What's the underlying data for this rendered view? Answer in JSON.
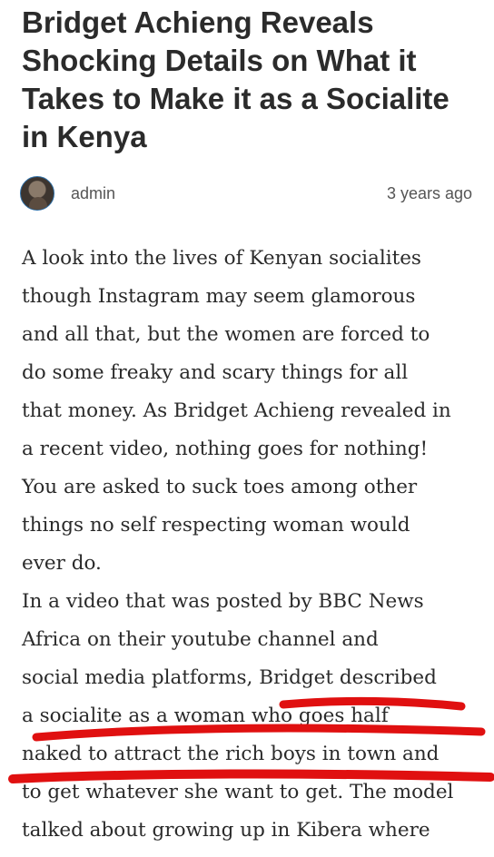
{
  "article": {
    "title": "Bridget Achieng Reveals Shocking Details on What it Takes to Make it as a Socialite in Kenya",
    "author": "admin",
    "time_ago": "3 years ago",
    "paragraphs": [
      "A look into the lives of Kenyan socialites\nthough Instagram may seem glamorous\nand all that, but the women are forced to\ndo some freaky and scary things for all\nthat money. As Bridget Achieng revealed in\na recent video, nothing goes for nothing!\nYou are asked to suck toes among other\nthings no self respecting woman would\never do.",
      "In a video that was posted by BBC News\nAfrica on their  youtube channel and\nsocial media platforms, Bridget described\na socialite as a woman who goes half\nnaked to attract the rich boys in town and\nto get whatever she want to get. The model\ntalked about growing up in Kibera where"
    ]
  },
  "colors": {
    "title": "#2b2b2b",
    "meta": "#555555",
    "body_text": "#2a2a2a",
    "annotation_marker": "#e01010"
  },
  "icons": {
    "avatar": "author-avatar-photo"
  }
}
